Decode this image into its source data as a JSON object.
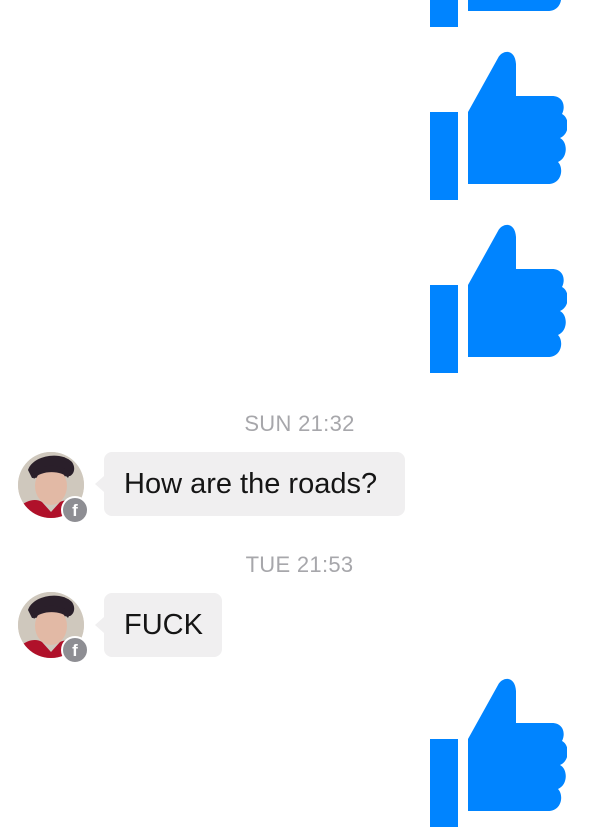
{
  "colors": {
    "like_blue": "#0084ff",
    "bubble_bg": "#f0eff0",
    "timestamp": "#a7a7ab"
  },
  "messages": [
    {
      "type": "like",
      "icon": "thumbs-up-icon",
      "sender": "me"
    },
    {
      "type": "like",
      "icon": "thumbs-up-icon",
      "sender": "me"
    },
    {
      "type": "like",
      "icon": "thumbs-up-icon",
      "sender": "me"
    },
    {
      "type": "timestamp",
      "text": "SUN 21:32"
    },
    {
      "type": "text",
      "sender": "contact",
      "text": "How are the roads?"
    },
    {
      "type": "timestamp",
      "text": "TUE 21:53"
    },
    {
      "type": "text",
      "sender": "contact",
      "text": "FUCK"
    },
    {
      "type": "like",
      "icon": "thumbs-up-icon",
      "sender": "me"
    }
  ],
  "contact": {
    "badge_icon": "facebook-icon",
    "badge_glyph": "f"
  }
}
